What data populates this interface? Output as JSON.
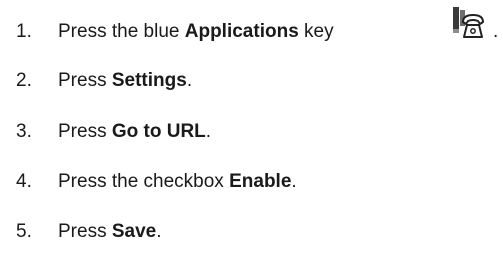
{
  "steps": [
    {
      "number": "1.",
      "prefix": "Press the blue ",
      "bold": "Applications",
      "suffix": " key",
      "trailing": "."
    },
    {
      "number": "2.",
      "prefix": "Press ",
      "bold": "Settings",
      "suffix": "."
    },
    {
      "number": "3.",
      "prefix": "Press ",
      "bold": "Go to URL",
      "suffix": "."
    },
    {
      "number": "4.",
      "prefix": "Press the checkbox ",
      "bold": "Enable",
      "suffix": "."
    },
    {
      "number": "5.",
      "prefix": "Press ",
      "bold": "Save",
      "suffix": "."
    }
  ],
  "icons": {
    "applications_key": "applications-key-icon"
  }
}
